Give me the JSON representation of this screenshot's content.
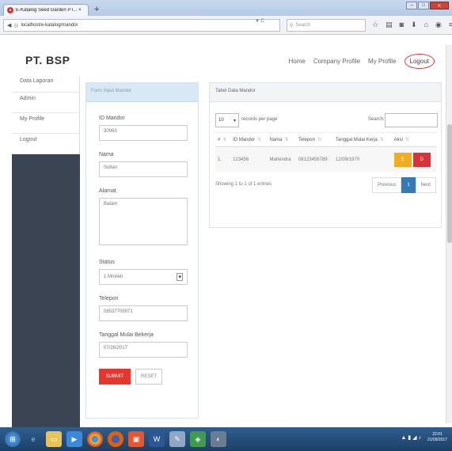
{
  "browser": {
    "tab_title": "E-Katalog Seed Garden PT... ×",
    "new_tab": "+",
    "url": "localhost/e-katalog/mandor",
    "search_placeholder": "Search",
    "reload_symbol": "▼ C"
  },
  "header": {
    "brand": "PT. BSP",
    "menu": [
      "Home",
      "Company Profile",
      "My Profile"
    ],
    "logout": "Logout"
  },
  "sidebar": {
    "items": [
      "Data Laporan",
      "Admin",
      "My Profile",
      "Logout"
    ]
  },
  "form": {
    "title": "Form Input Mandor",
    "fields": [
      {
        "label": "ID Mandor",
        "value": "30063"
      },
      {
        "label": "Nama",
        "value": "Sultan"
      },
      {
        "label": "Alamat",
        "value": "Batam"
      },
      {
        "label": "Status",
        "value": "1 Mmileh"
      },
      {
        "label": "Telepon",
        "value": "08537709971"
      },
      {
        "label": "Tanggal Mulai Bekerja",
        "value": "07/26/2017"
      }
    ],
    "submit": "SUBMIT",
    "reset": "RESET"
  },
  "table": {
    "title": "Tabel Data Mandor",
    "length_value": "10",
    "length_text": "records per page",
    "search_label": "Search:",
    "columns": [
      "#",
      "ID Mandor",
      "Nama",
      "Telepon",
      "Tanggal Mulai Kerja",
      "Aksi"
    ],
    "rows": [
      {
        "no": "1.",
        "id": "123456",
        "nama": "Mahendra",
        "telepon": "08123456789",
        "tanggal": "12/09/1970"
      }
    ],
    "edit_label": "E",
    "delete_label": "D",
    "info": "Showing 1 to 1 of 1 entries",
    "pager": {
      "prev": "Previous",
      "page": "1",
      "next": "Next"
    }
  },
  "taskbar": {
    "time": "22:01",
    "date": "21/09/2017"
  },
  "colors": {
    "sidebar_bg": "#3a4453",
    "submit": "#e8362c",
    "edit": "#f0ad1e",
    "delete": "#d9333a",
    "pager_active": "#337ab7",
    "logout_ring": "#d23a2f"
  }
}
